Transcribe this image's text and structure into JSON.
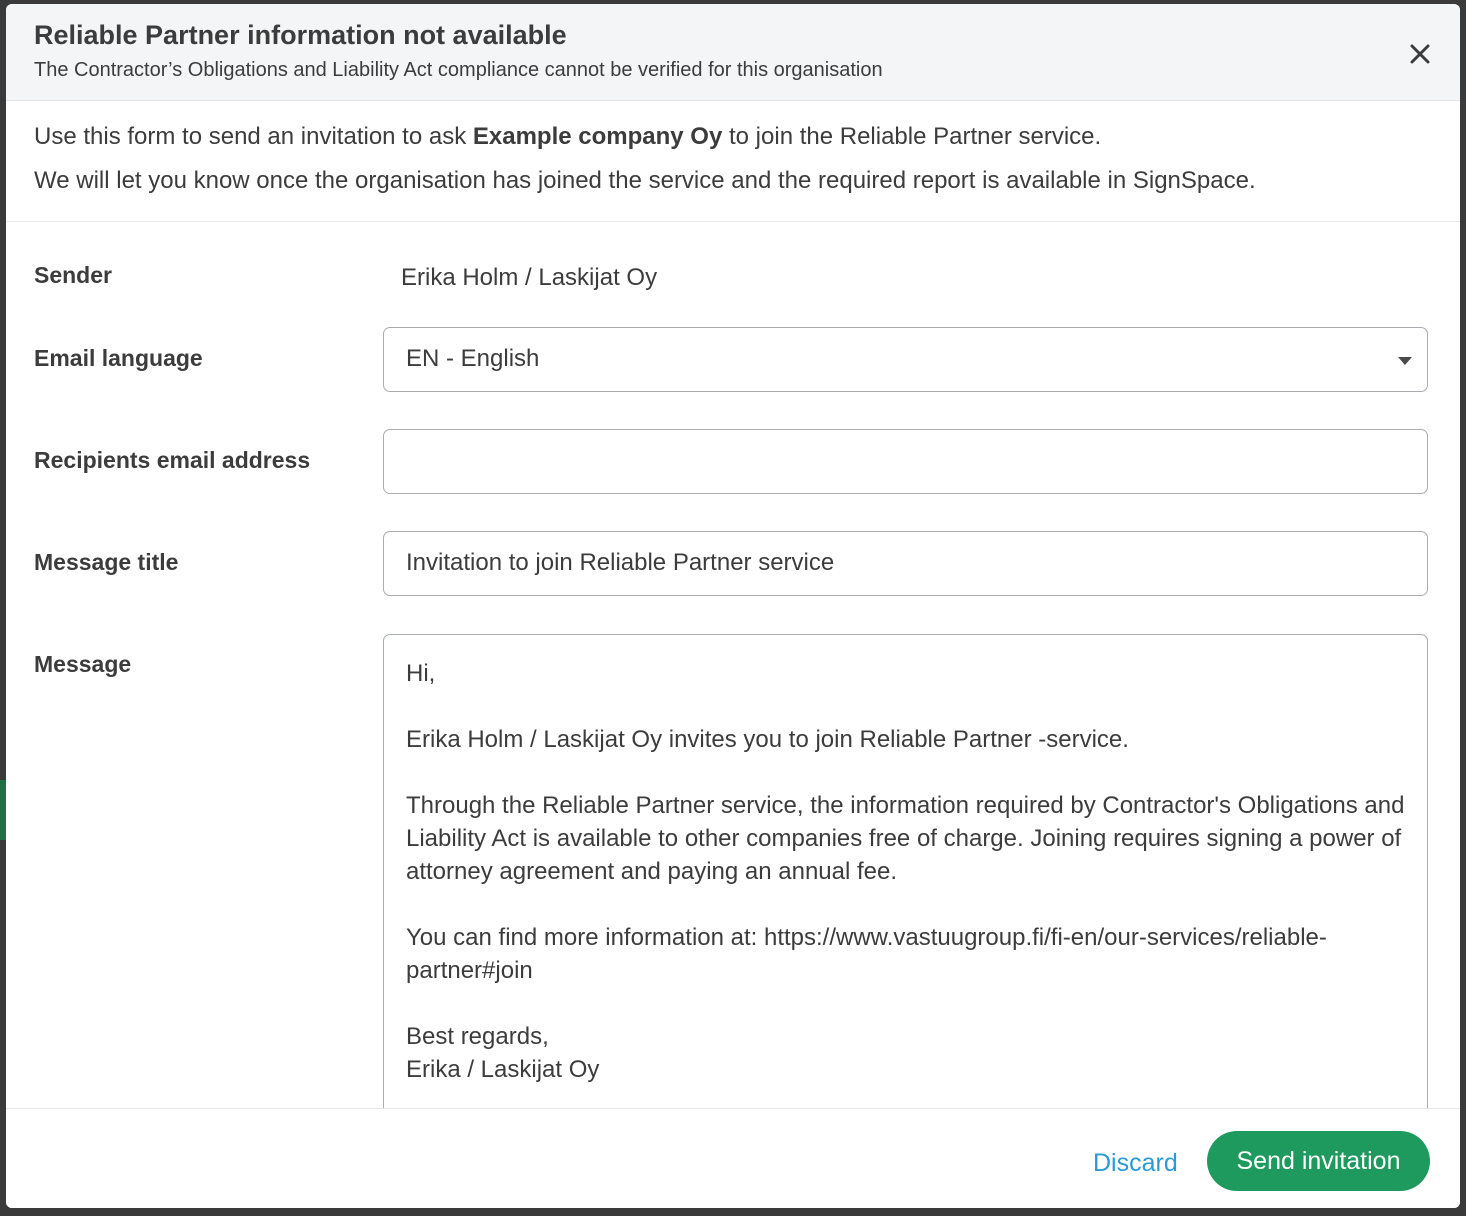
{
  "dialog": {
    "title": "Reliable Partner information not available",
    "subtitle": "The Contractor’s Obligations and Liability Act compliance cannot be verified for this organisation",
    "close_icon": "close-icon"
  },
  "intro": {
    "line1_pre": "Use this form to send an invitation to ask ",
    "line1_company": "Example company Oy",
    "line1_post": " to join the Reliable Partner service.",
    "line2": "We will let you know once the organisation has joined the service and the required report is available in SignSpace."
  },
  "form": {
    "sender_label": "Sender",
    "sender_value": "Erika Holm / Laskijat Oy",
    "language_label": "Email language",
    "language_selected": "EN - English",
    "recipient_label": "Recipients email address",
    "recipient_value": "",
    "title_label": "Message title",
    "title_value": "Invitation to join Reliable Partner service",
    "message_label": "Message",
    "message": {
      "greeting": "Hi,",
      "invite": "Erika Holm / Laskijat Oy invites you to join Reliable Partner -service.",
      "body": "Through the Reliable Partner service, the information required by Contractor's Obligations and Liability Act is available to other companies free of charge. Joining requires signing a power of attorney agreement and paying an annual fee.",
      "more_info": "You can find more information at: https://www.vastuugroup.fi/fi-en/our-services/reliable-partner#join",
      "regards": "Best regards,",
      "signature": "Erika / Laskijat Oy"
    }
  },
  "footer": {
    "discard_label": "Discard",
    "send_label": "Send invitation"
  },
  "colors": {
    "accent_green": "#1e9a5e",
    "link_blue": "#2b9ad6",
    "header_bg": "#f4f5f6"
  }
}
